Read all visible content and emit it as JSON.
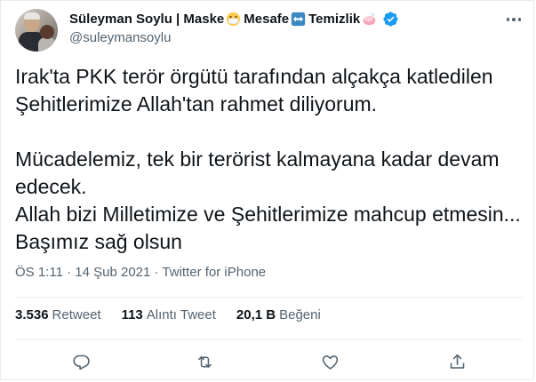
{
  "user": {
    "display_name_parts": [
      "Süleyman Soylu | Maske",
      "Mesafe",
      "Temizlik"
    ],
    "handle": "@suleymansoylu",
    "icons": [
      "mask-emoji-icon",
      "left-right-arrow-icon",
      "soap-icon",
      "verified-badge-icon"
    ]
  },
  "tweet": {
    "text": "Irak'ta PKK terör örgütü tarafından alçakça katledilen\nŞehitlerimize Allah'tan rahmet diliyorum.\n\nMücadelemiz, tek bir terörist kalmayana kadar devam\nedecek.\nAllah bizi Milletimize ve Şehitlerimize mahcup etmesin...\nBaşımız sağ olsun",
    "time": "ÖS 1:11",
    "separator": "·",
    "date": "14 Şub 2021",
    "source": "Twitter for iPhone"
  },
  "stats": {
    "retweets": {
      "count": "3.536",
      "label": "Retweet"
    },
    "quotes": {
      "count": "113",
      "label": "Alıntı Tweet"
    },
    "likes": {
      "count": "20,1 B",
      "label": "Beğeni"
    }
  },
  "actions": [
    "reply-icon",
    "retweet-icon",
    "like-icon",
    "share-icon"
  ],
  "colors": {
    "text": "#0f1419",
    "secondary": "#536471",
    "verified": "#1d9bf0",
    "divider": "#e6ecf0"
  }
}
